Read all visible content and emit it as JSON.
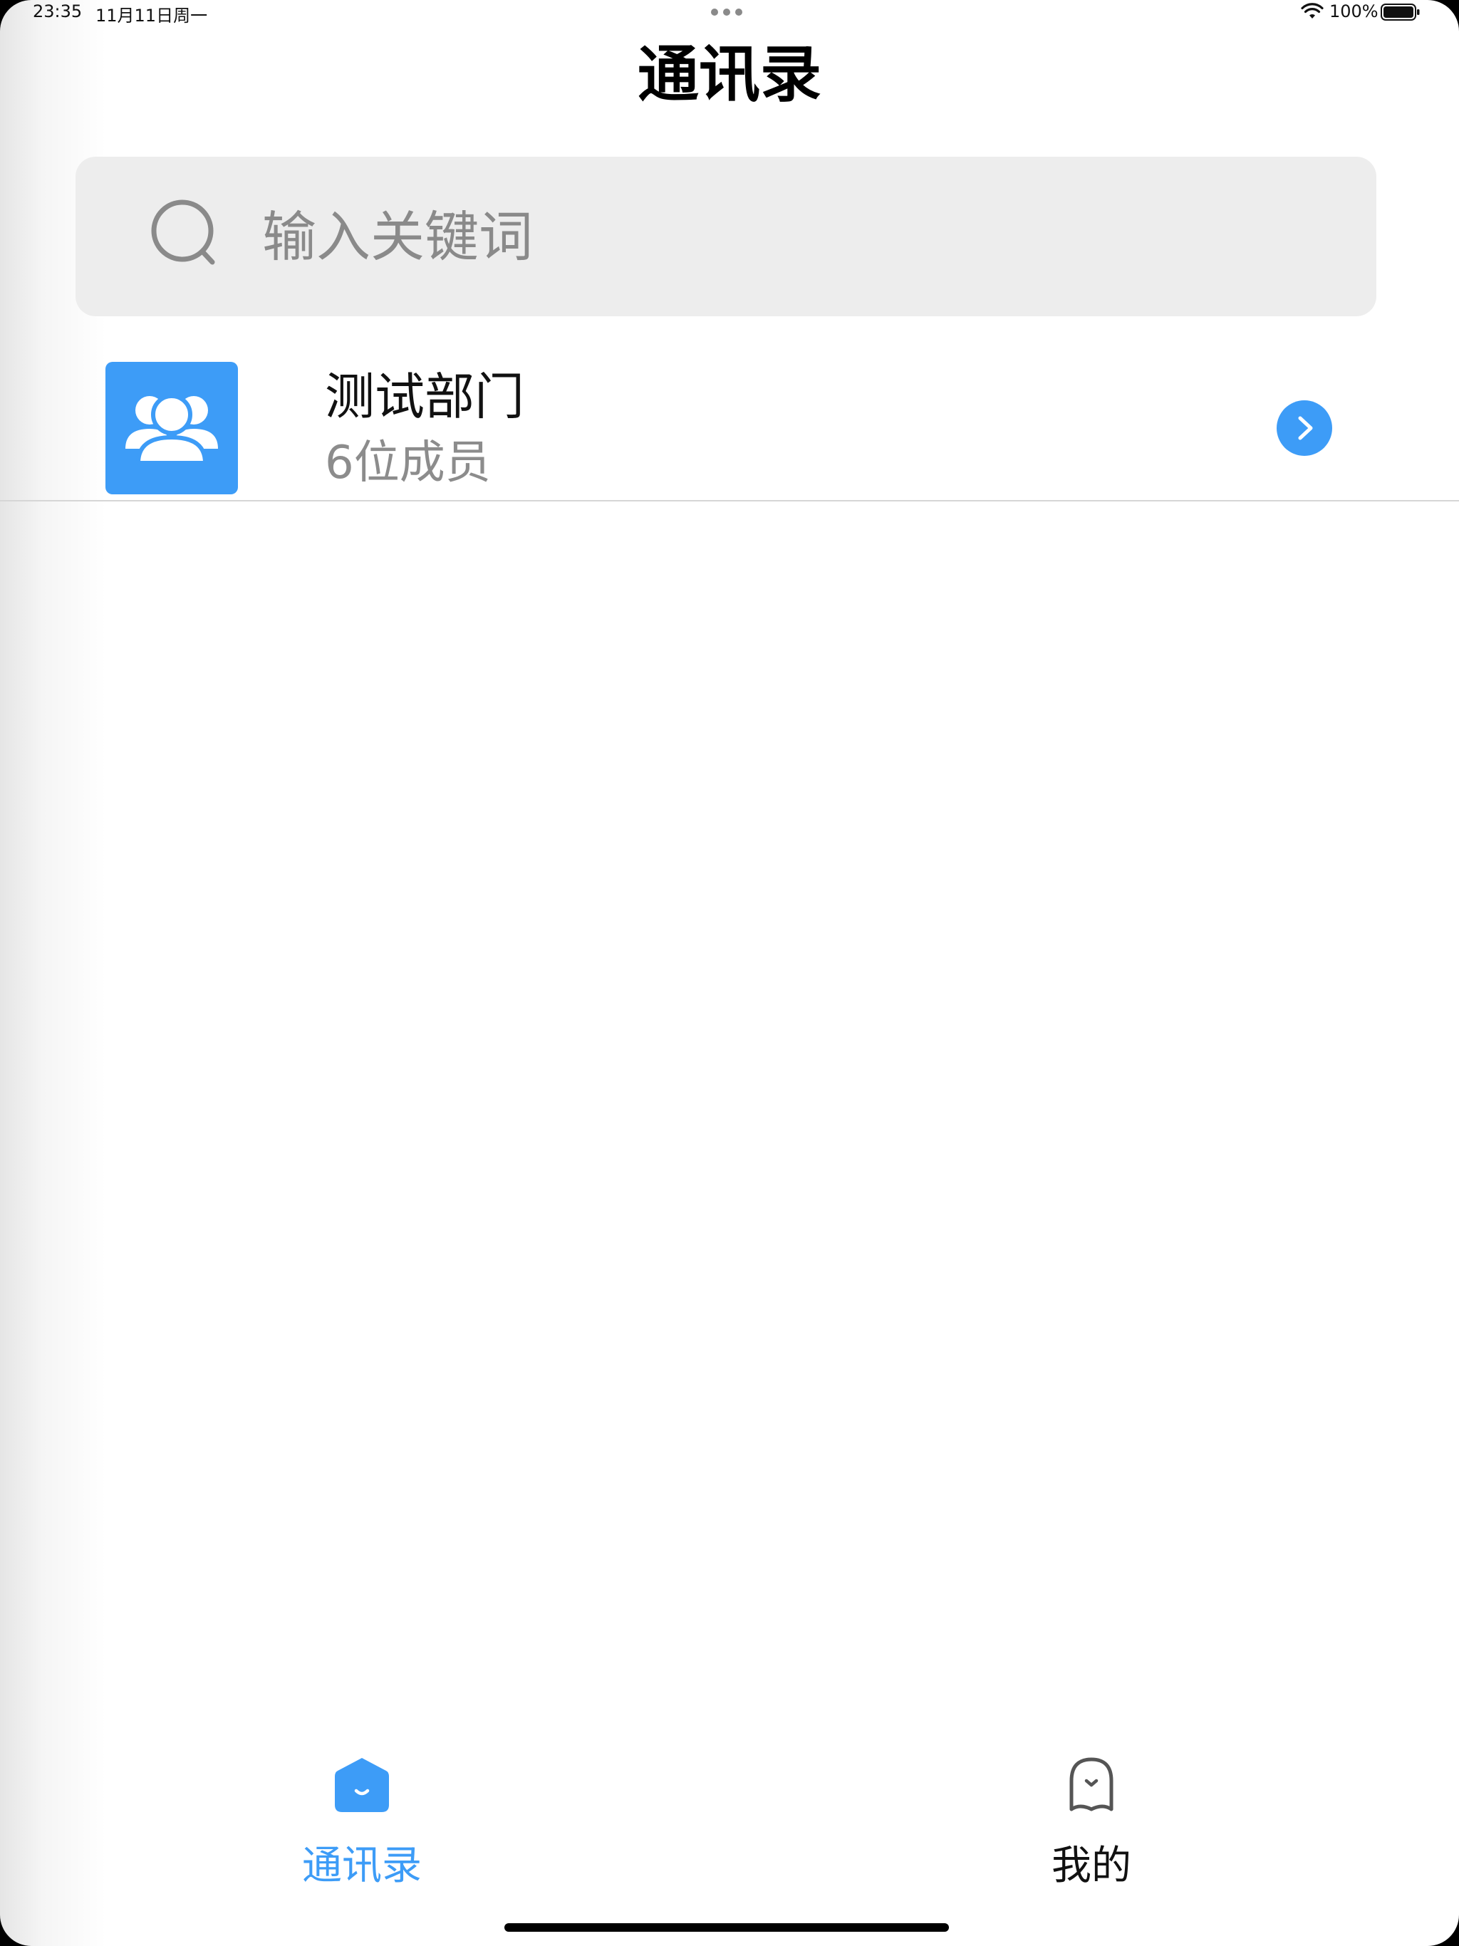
{
  "status_bar": {
    "time": "23:35",
    "date": "11月11日周一",
    "battery_percent": "100%",
    "battery_level": 1.0
  },
  "header": {
    "title": "通讯录"
  },
  "search": {
    "placeholder": "输入关键词",
    "value": ""
  },
  "departments": [
    {
      "name": "测试部门",
      "member_count": "6位成员",
      "icon": "group-icon"
    }
  ],
  "tabbar": {
    "items": [
      {
        "label": "通讯录",
        "icon": "contacts-home-icon",
        "active": true
      },
      {
        "label": "我的",
        "icon": "profile-icon",
        "active": false
      }
    ]
  },
  "colors": {
    "accent": "#3d9cf7",
    "search_bg": "#ededed",
    "secondary_text": "#8c8c8c",
    "divider": "#d6d6d6"
  }
}
